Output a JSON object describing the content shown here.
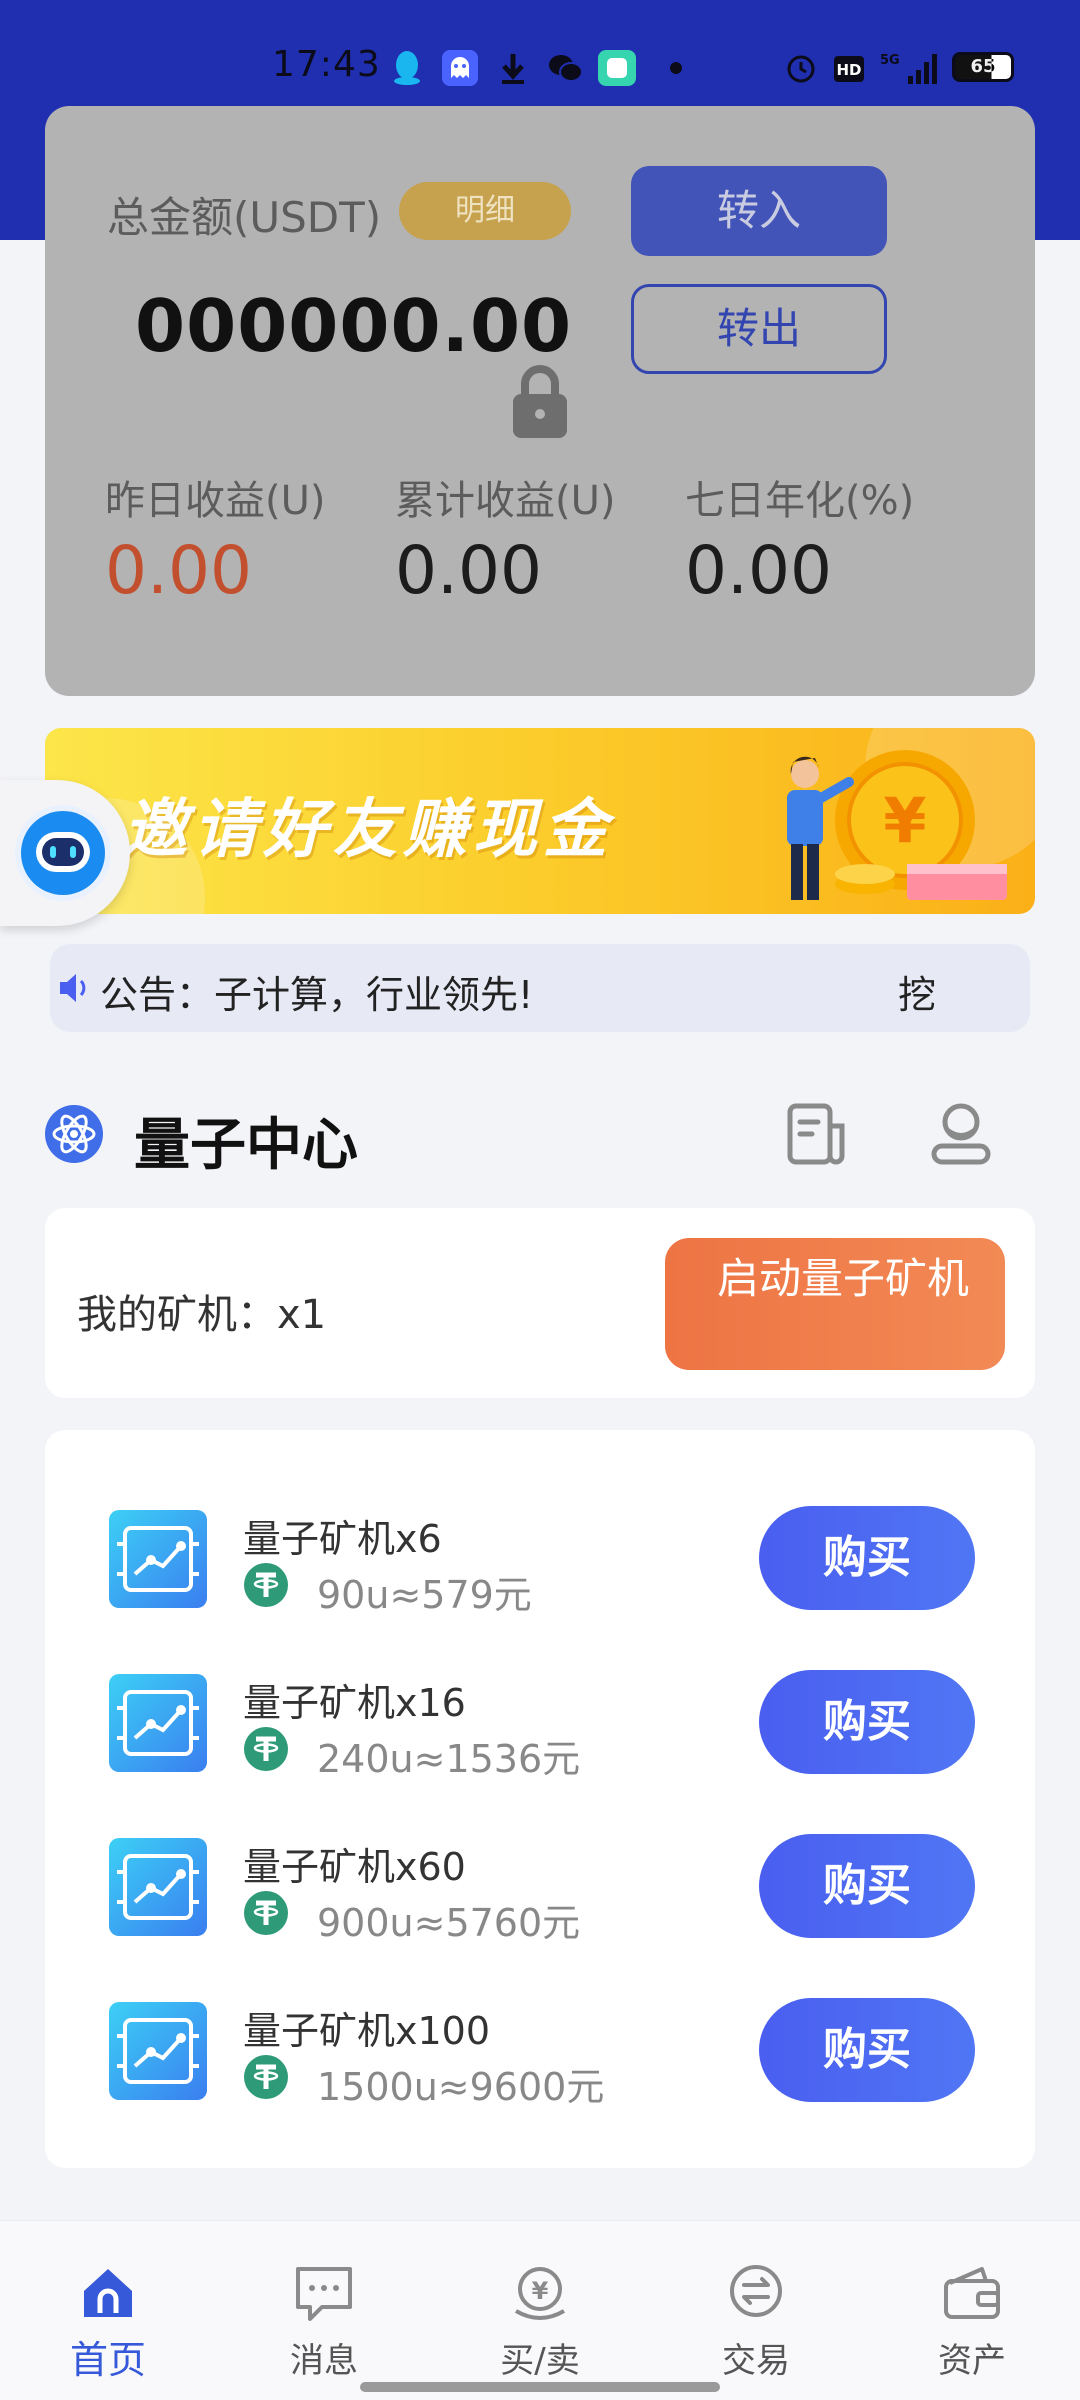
{
  "status_bar": {
    "time": "17:43",
    "battery": "65",
    "icons": [
      "qq-icon",
      "ghost-app-icon",
      "download-icon",
      "wechat-icon",
      "app-icon",
      "alarm-icon",
      "hd-icon",
      "5g-signal-icon",
      "battery-icon"
    ]
  },
  "balance": {
    "total_label": "总金额(USDT)",
    "detail_label": "明细",
    "transfer_in_label": "转入",
    "transfer_out_label": "转出",
    "total_amount": "000000.00",
    "stats": [
      {
        "label": "昨日收益(U)",
        "value": "0.00"
      },
      {
        "label": "累计收益(U)",
        "value": "0.00"
      },
      {
        "label": "七日年化(%)",
        "value": "0.00"
      }
    ]
  },
  "banner": {
    "text": "邀请好友赚现金"
  },
  "notice": {
    "text": "公告：子计算，行业领先!",
    "tail": "挖"
  },
  "quantum": {
    "title": "量子中心",
    "my_miner_label": "我的矿机：x1",
    "start_button_label": "启动量子矿机",
    "products": [
      {
        "name": "量子矿机x6",
        "price": "90u≈579元",
        "button": "购买"
      },
      {
        "name": "量子矿机x16",
        "price": "240u≈1536元",
        "button": "购买"
      },
      {
        "name": "量子矿机x60",
        "price": "900u≈5760元",
        "button": "购买"
      },
      {
        "name": "量子矿机x100",
        "price": "1500u≈9600元",
        "button": "购买"
      }
    ]
  },
  "nav": {
    "items": [
      {
        "label": "首页",
        "icon": "home-icon",
        "active": true
      },
      {
        "label": "消息",
        "icon": "message-icon"
      },
      {
        "label": "买/卖",
        "icon": "buy-sell-icon"
      },
      {
        "label": "交易",
        "icon": "exchange-icon"
      },
      {
        "label": "资产",
        "icon": "wallet-icon"
      }
    ]
  },
  "colors": {
    "header_blue": "#1f2fb0",
    "accent_blue": "#4a5ef0",
    "orange": "#ee7444",
    "red_value": "#c2502f",
    "gold_badge": "#c7a24e",
    "nav_active": "#3559d9"
  }
}
